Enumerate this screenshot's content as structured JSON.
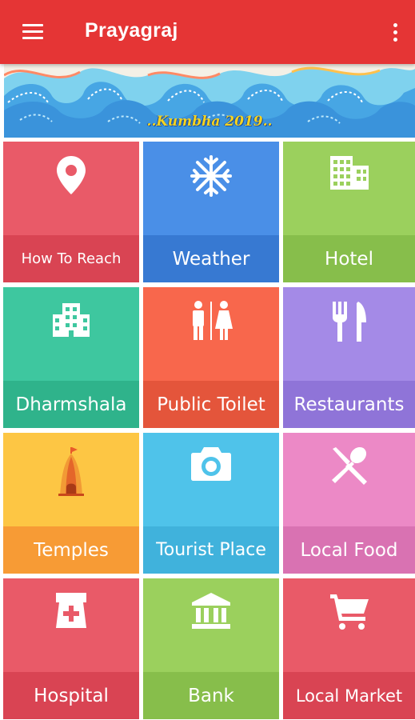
{
  "app_bar": {
    "title": "Prayagraj",
    "menu_icon": "hamburger-menu-icon",
    "overflow_icon": "more-vertical-icon",
    "color": "#e53535"
  },
  "banner": {
    "text": "..Kumbha 2019.."
  },
  "tiles": [
    {
      "label": "How To Reach",
      "icon": "map-pin-icon",
      "color": "#e95a68",
      "band_color": "#d94453"
    },
    {
      "label": "Weather",
      "icon": "snowflake-icon",
      "color": "#4a8fe7",
      "band_color": "#3779d2"
    },
    {
      "label": "Hotel",
      "icon": "building-icon",
      "color": "#9bd05d",
      "band_color": "#87be4b"
    },
    {
      "label": "Dharmshala",
      "icon": "hostel-building-icon",
      "color": "#3ec79f",
      "band_color": "#2fb38b"
    },
    {
      "label": "Public Toilet",
      "icon": "restroom-icon",
      "color": "#f8674c",
      "band_color": "#e4553b"
    },
    {
      "label": "Restaurants",
      "icon": "fork-knife-icon",
      "color": "#a48ae7",
      "band_color": "#8f74d8"
    },
    {
      "label": "Temples",
      "icon": "temple-icon",
      "color": "#fdc644",
      "band_color": "#f79b35"
    },
    {
      "label": "Tourist Place",
      "icon": "camera-icon",
      "color": "#4fc3ea",
      "band_color": "#40b2dc"
    },
    {
      "label": "Local Food",
      "icon": "utensils-crossed-icon",
      "color": "#ec89c6",
      "band_color": "#d972b2"
    },
    {
      "label": "Hospital",
      "icon": "medicine-jar-icon",
      "color": "#e95a68",
      "band_color": "#d94453"
    },
    {
      "label": "Bank",
      "icon": "bank-icon",
      "color": "#9bd05d",
      "band_color": "#87be4b"
    },
    {
      "label": "Local Market",
      "icon": "shopping-cart-icon",
      "color": "#e95a68",
      "band_color": "#d94453"
    }
  ]
}
